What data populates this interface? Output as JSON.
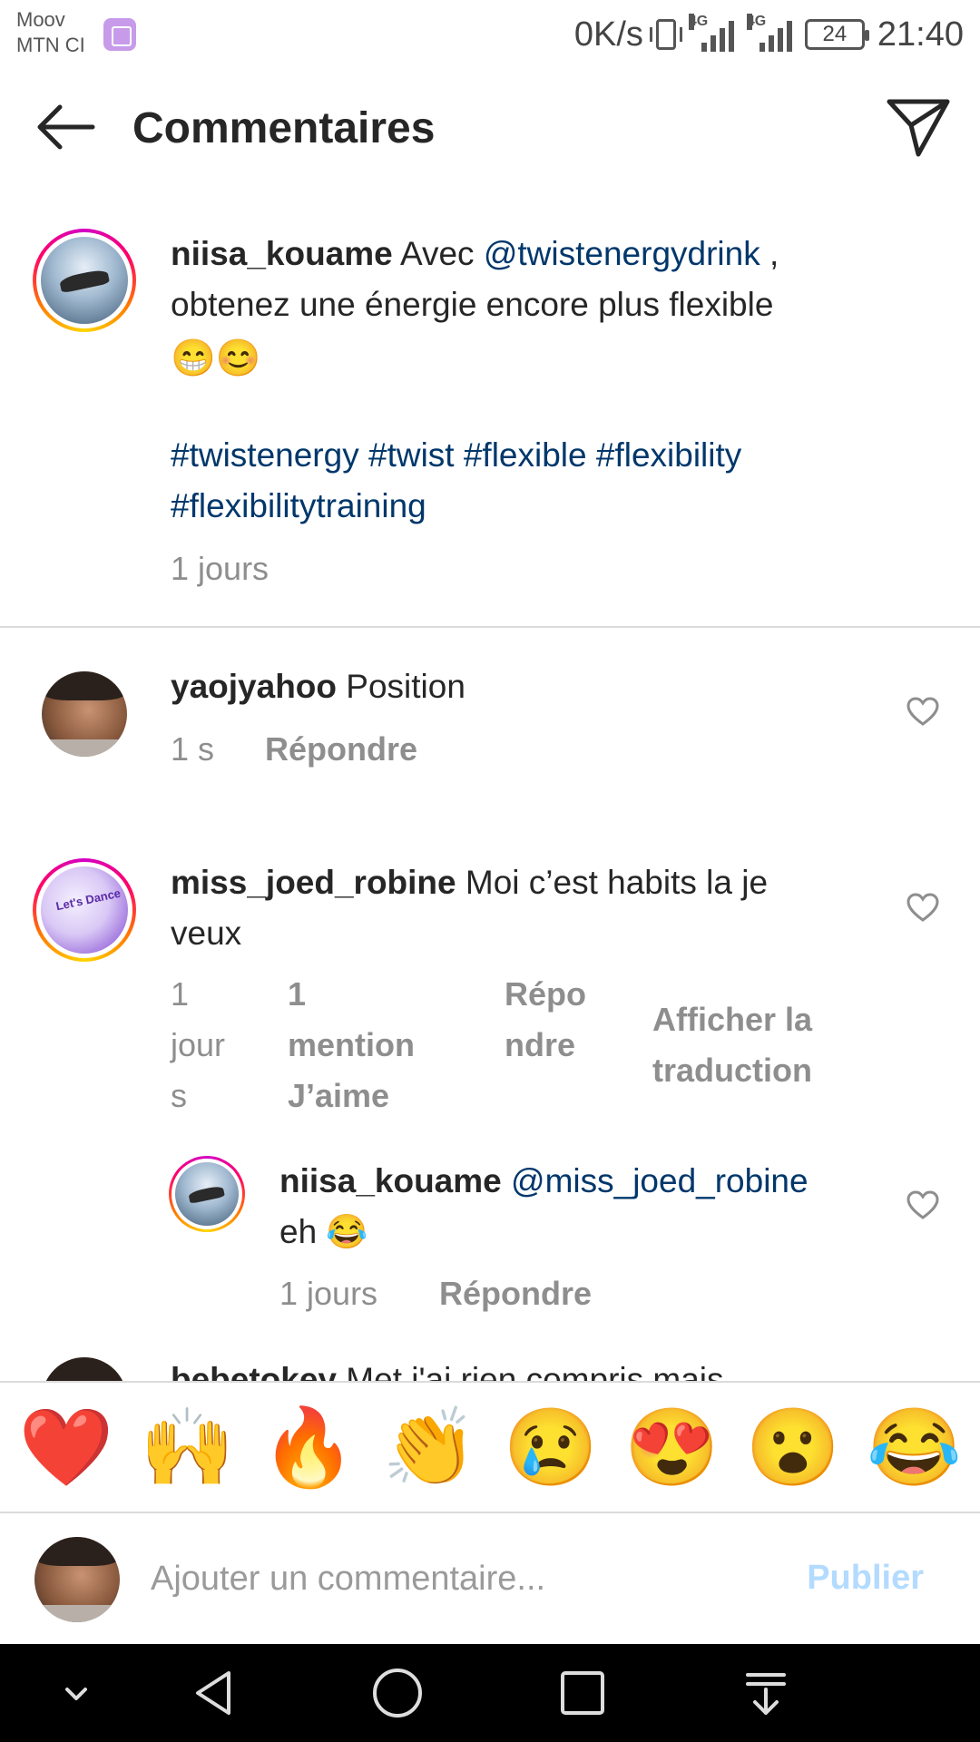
{
  "status_bar": {
    "carrier_line1": "Moov",
    "carrier_line2": "MTN CI",
    "net_speed": "0K/s",
    "network1": "4G",
    "network2": "4G",
    "battery": "24",
    "time": "21:40"
  },
  "header": {
    "title": "Commentaires"
  },
  "caption": {
    "username": "niisa_kouame",
    "text_before": " Avec ",
    "mention": "@twistenergydrink",
    "text_after": " ,",
    "line2": "obtenez une énergie encore plus flexible",
    "emojis": "😁😊",
    "hashtags_line1": "#twistenergy #twist #flexible #flexibility",
    "hashtags_line2": "#flexibilitytraining",
    "time": "1 jours"
  },
  "comments": [
    {
      "username": "yaojyahoo",
      "text": " Position",
      "time": "1 s",
      "reply": "Répondre"
    },
    {
      "username": "miss_joed_robine",
      "text": " Moi c’est habits la je",
      "text_line2": "veux",
      "time_l1": "1",
      "time_l2": "jour",
      "time_l3": "s",
      "likes_l1": "1",
      "likes_l2": "mention",
      "likes_l3": "J’aime",
      "reply_l1": "Répo",
      "reply_l2": "ndre",
      "translate_l1": "Afficher la",
      "translate_l2": "traduction",
      "avatar_text": "Let's Dance"
    }
  ],
  "reply": {
    "username": "niisa_kouame",
    "mention": " @miss_joed_robine",
    "text": "eh 😂",
    "time": "1 jours",
    "reply": "Répondre"
  },
  "partial_comment": {
    "username": "bebetokey",
    "text": " Met j'ai rien compris mais"
  },
  "emoji_bar": [
    "❤️",
    "🙌",
    "🔥",
    "👏",
    "😢",
    "😍",
    "😮",
    "😂"
  ],
  "compose": {
    "placeholder": "Ajouter un commentaire...",
    "publish": "Publier"
  },
  "colors": {
    "link": "#00376b",
    "muted": "#8e8e8e",
    "publish_disabled": "#b3dbff"
  }
}
